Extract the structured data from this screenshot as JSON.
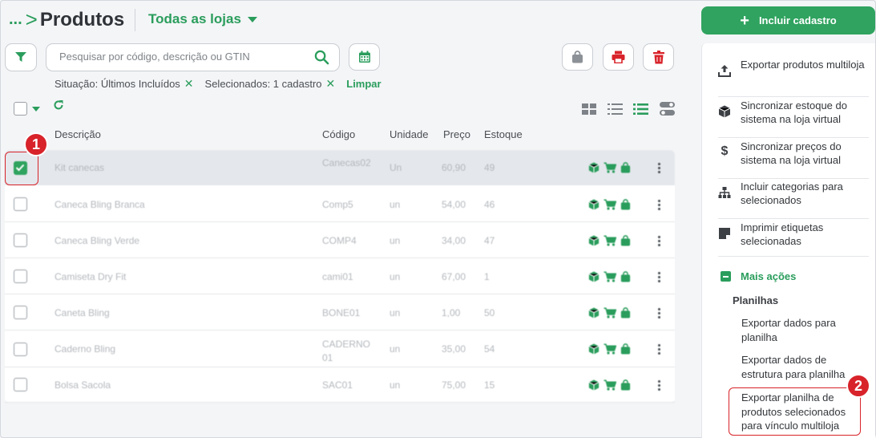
{
  "header": {
    "breadcrumb_dots": "...",
    "breadcrumb_sep": ">",
    "title": "Produtos",
    "store_selector": "Todas as lojas"
  },
  "toolbar": {
    "search_placeholder": "Pesquisar por código, descrição ou GTIN"
  },
  "filters": {
    "situacao": "Situação: Últimos Incluídos",
    "selecionados": "Selecionados: 1 cadastro",
    "remove_symbol": "✕",
    "limpar": "Limpar"
  },
  "table": {
    "headers": {
      "descricao": "Descrição",
      "codigo": "Código",
      "unidade": "Unidade",
      "preco": "Preço",
      "estoque": "Estoque"
    },
    "rows": [
      {
        "descricao": "Kit canecas",
        "codigo": "Canecas02",
        "unidade": "Un",
        "preco": "60,90",
        "estoque": "49",
        "checked": true
      },
      {
        "descricao": "Caneca Bling Branca",
        "codigo": "Comp5",
        "unidade": "un",
        "preco": "54,00",
        "estoque": "46",
        "checked": false
      },
      {
        "descricao": "Caneca Bling Verde",
        "codigo": "COMP4",
        "unidade": "un",
        "preco": "34,00",
        "estoque": "47",
        "checked": false
      },
      {
        "descricao": "Camiseta Dry Fit",
        "codigo": "cami01",
        "unidade": "un",
        "preco": "67,00",
        "estoque": "1",
        "checked": false
      },
      {
        "descricao": "Caneta Bling",
        "codigo": "BONE01",
        "unidade": "un",
        "preco": "1,00",
        "estoque": "50",
        "checked": false
      },
      {
        "descricao": "Caderno Bling",
        "codigo": "CADERNO 01",
        "unidade": "un",
        "preco": "35,00",
        "estoque": "54",
        "checked": false
      },
      {
        "descricao": "Bolsa Sacola",
        "codigo": "SAC01",
        "unidade": "un",
        "preco": "75,00",
        "estoque": "15",
        "checked": false
      }
    ]
  },
  "sidebar": {
    "include_button": "Incluir cadastro",
    "actions": [
      {
        "label": "Exportar produtos multiloja",
        "icon": "upload-icon"
      },
      {
        "label": "Sincronizar estoque do sistema na loja virtual",
        "icon": "box-icon"
      },
      {
        "label": "Sincronizar preços do sistema na loja virtual",
        "icon": "dollar-icon"
      },
      {
        "label": "Incluir categorias para selecionados",
        "icon": "sitemap-icon"
      },
      {
        "label": "Imprimir etiquetas selecionadas",
        "icon": "label-icon"
      }
    ],
    "more_actions": "Mais ações",
    "planilhas_title": "Planilhas",
    "planilhas": [
      "Exportar dados para planilha",
      "Exportar dados de estrutura para planilha",
      "Exportar planilha de produtos selecionados para vínculo multiloja"
    ]
  },
  "annotations": {
    "step1": "1",
    "step2": "2"
  },
  "colors": {
    "accent": "#2a9d5c",
    "danger": "#d8232a",
    "annotation": "#d8232a"
  }
}
